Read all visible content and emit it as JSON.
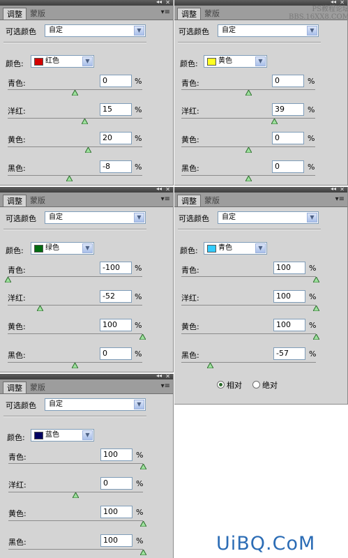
{
  "site_watermark": "UiBQ.CoM",
  "forum_line1": "PS教程论坛",
  "forum_line2": "BBS.16XX8.COM",
  "ui_labels": {
    "tab_adjust": "调整",
    "tab_mask": "蒙版",
    "selective_color": "可选颜色",
    "colors_label": "颜色:",
    "cyan": "青色:",
    "magenta": "洋红:",
    "yellow": "黄色:",
    "black": "黑色:",
    "percent": "%",
    "preset": "自定",
    "collapse_glyph": "◂◂",
    "close_glyph": "✕",
    "menu_glyph": "▾≡",
    "dropdown_glyph": "▼"
  },
  "panels": [
    {
      "color_name": "红色",
      "swatch_color": "#d40000",
      "values": [
        "0",
        "15",
        "20",
        "-8"
      ],
      "slider_pct": [
        0.5,
        0.575,
        0.6,
        0.46
      ]
    },
    {
      "color_name": "黄色",
      "swatch_color": "#ffff22",
      "values": [
        "0",
        "39",
        "0",
        "0"
      ],
      "slider_pct": [
        0.5,
        0.695,
        0.5,
        0.5
      ]
    },
    {
      "color_name": "绿色",
      "swatch_color": "#006b10",
      "values": [
        "-100",
        "-52",
        "100",
        "0"
      ],
      "slider_pct": [
        0.0,
        0.24,
        1.0,
        0.5
      ]
    },
    {
      "color_name": "青色",
      "swatch_color": "#33ccff",
      "values": [
        "100",
        "100",
        "100",
        "-57"
      ],
      "slider_pct": [
        1.0,
        1.0,
        1.0,
        0.215
      ]
    },
    {
      "color_name": "蓝色",
      "swatch_color": "#000060",
      "values": [
        "100",
        "0",
        "100",
        "100"
      ],
      "slider_pct": [
        1.0,
        0.5,
        1.0,
        1.0
      ]
    }
  ],
  "method": {
    "relative": "相对",
    "absolute": "绝对",
    "selected": "relative"
  }
}
